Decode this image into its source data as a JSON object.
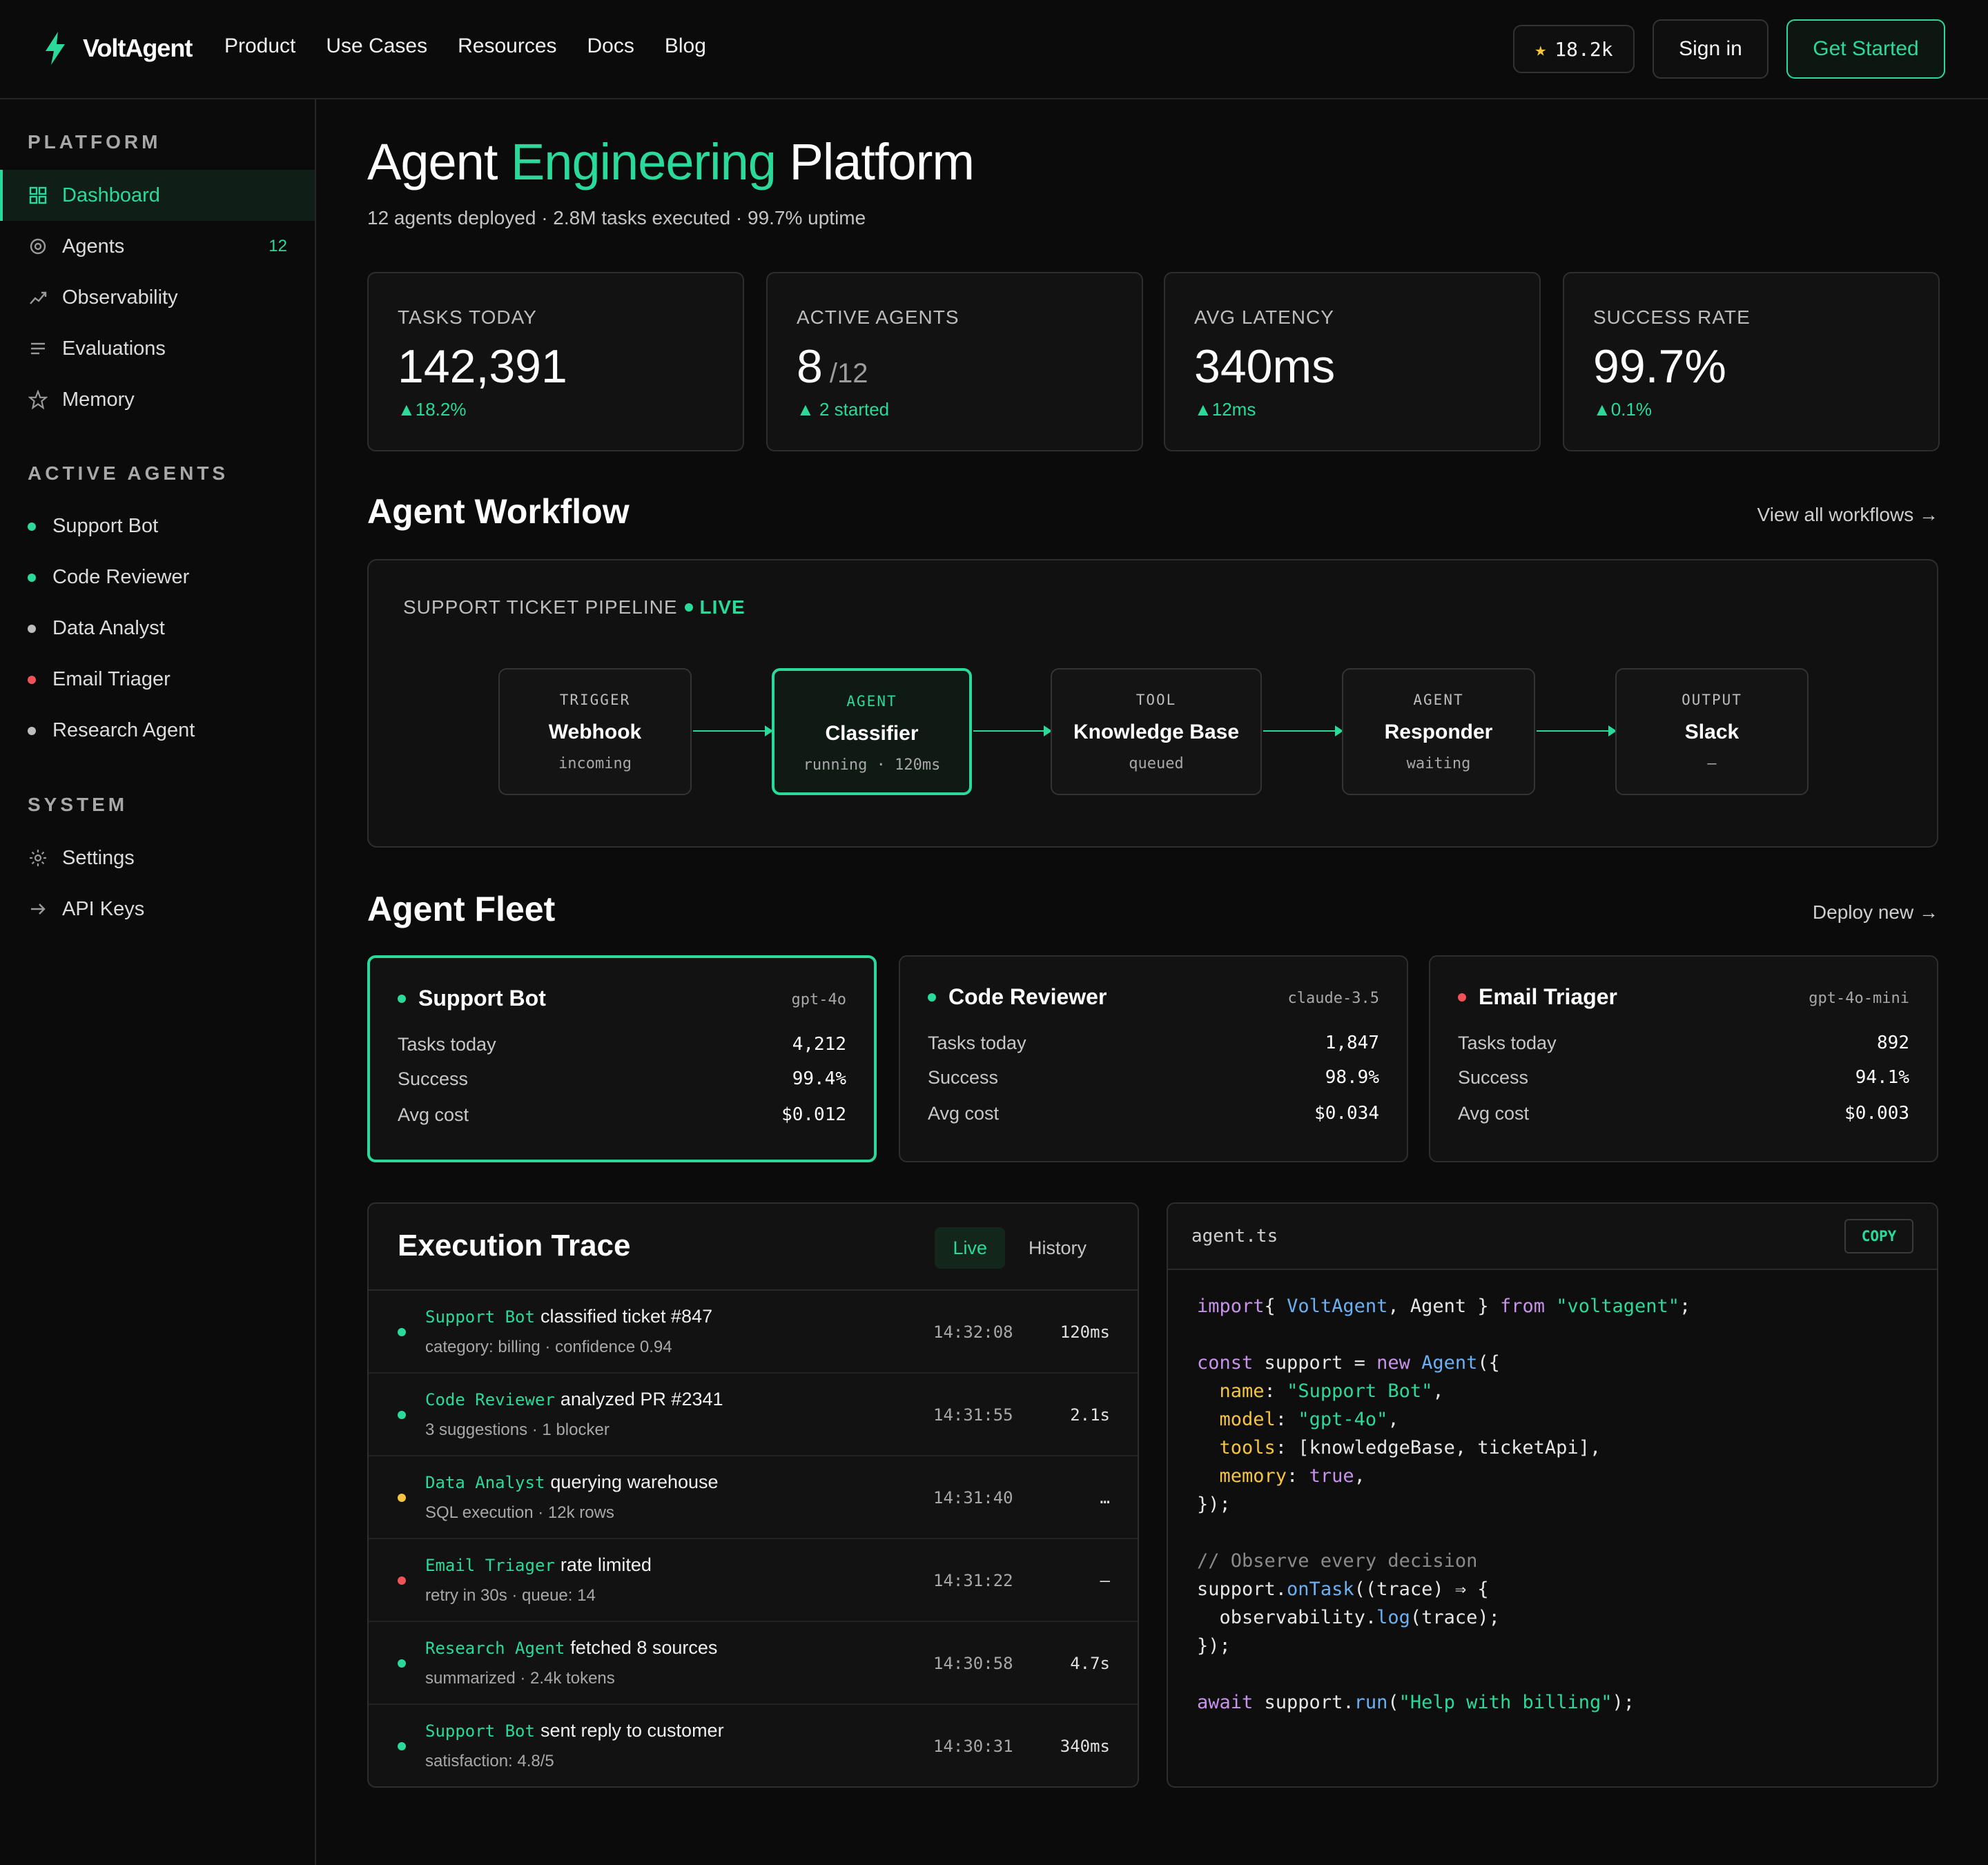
{
  "brand": {
    "name": "VoltAgent",
    "accent": "#2bd99a"
  },
  "nav": {
    "items": [
      "Product",
      "Use Cases",
      "Resources",
      "Docs",
      "Blog"
    ]
  },
  "actions": {
    "stars": "18.2k",
    "signin": "Sign in",
    "get_started": "Get Started"
  },
  "sidebar": {
    "platform_heading": "PLATFORM",
    "platform": [
      {
        "label": "Dashboard",
        "icon": "grid-icon"
      },
      {
        "label": "Agents",
        "icon": "target-icon",
        "badge": "12"
      },
      {
        "label": "Observability",
        "icon": "trend-icon"
      },
      {
        "label": "Evaluations",
        "icon": "list-icon"
      },
      {
        "label": "Memory",
        "icon": "star-icon"
      }
    ],
    "agents_heading": "ACTIVE AGENTS",
    "agents": [
      {
        "label": "Support Bot",
        "status": "green"
      },
      {
        "label": "Code Reviewer",
        "status": "green"
      },
      {
        "label": "Data Analyst",
        "status": "gray"
      },
      {
        "label": "Email Triager",
        "status": "red"
      },
      {
        "label": "Research Agent",
        "status": "gray"
      }
    ],
    "system_heading": "SYSTEM",
    "system": [
      {
        "label": "Settings",
        "icon": "gear-icon"
      },
      {
        "label": "API Keys",
        "icon": "arrow-right-icon"
      }
    ]
  },
  "header": {
    "title_pre": "Agent ",
    "title_hl": "Engineering",
    "title_post": " Platform",
    "subtitle": "12 agents deployed · 2.8M tasks executed · 99.7% uptime"
  },
  "stats": [
    {
      "label": "TASKS TODAY",
      "value": "142,391",
      "suffix": "",
      "delta": "18.2%"
    },
    {
      "label": "ACTIVE AGENTS",
      "value": "8",
      "suffix": "/12",
      "delta": "2 started"
    },
    {
      "label": "AVG LATENCY",
      "value": "340ms",
      "suffix": "",
      "delta": "12ms"
    },
    {
      "label": "SUCCESS RATE",
      "value": "99.7%",
      "suffix": "",
      "delta": "0.1%"
    }
  ],
  "workflow": {
    "title": "Agent Workflow",
    "link": "View all workflows →",
    "pipeline": "SUPPORT TICKET PIPELINE",
    "live": "LIVE",
    "nodes": [
      {
        "kind": "TRIGGER",
        "name": "Webhook",
        "status": "incoming"
      },
      {
        "kind": "AGENT",
        "name": "Classifier",
        "status": "running · 120ms"
      },
      {
        "kind": "TOOL",
        "name": "Knowledge Base",
        "status": "queued"
      },
      {
        "kind": "AGENT",
        "name": "Responder",
        "status": "waiting"
      },
      {
        "kind": "OUTPUT",
        "name": "Slack",
        "status": "—"
      }
    ]
  },
  "fleet": {
    "title": "Agent Fleet",
    "link": "Deploy new →",
    "labels": {
      "tasks": "Tasks today",
      "success": "Success",
      "cost": "Avg cost"
    },
    "cards": [
      {
        "name": "Support Bot",
        "model": "gpt-4o",
        "tasks": "4,212",
        "success": "99.4%",
        "cost": "$0.012"
      },
      {
        "name": "Code Reviewer",
        "model": "claude-3.5",
        "tasks": "1,847",
        "success": "98.9%",
        "cost": "$0.034"
      },
      {
        "name": "Email Triager",
        "model": "gpt-4o-mini",
        "tasks": "892",
        "success": "94.1%",
        "cost": "$0.003"
      }
    ]
  },
  "trace": {
    "title": "Execution Trace",
    "tabs": [
      "Live",
      "History"
    ],
    "rows": [
      {
        "agent": "Support Bot",
        "action": "classified ticket #847",
        "detail": "category: billing · confidence 0.94",
        "time": "14:32:08",
        "dur": "120ms",
        "status": "green"
      },
      {
        "agent": "Code Reviewer",
        "action": "analyzed PR #2341",
        "detail": "3 suggestions · 1 blocker",
        "time": "14:31:55",
        "dur": "2.1s",
        "status": "green"
      },
      {
        "agent": "Data Analyst",
        "action": "querying warehouse",
        "detail": "SQL execution · 12k rows",
        "time": "14:31:40",
        "dur": "…",
        "status": "yellow"
      },
      {
        "agent": "Email Triager",
        "action": "rate limited",
        "detail": "retry in 30s · queue: 14",
        "time": "14:31:22",
        "dur": "—",
        "status": "red"
      },
      {
        "agent": "Research Agent",
        "action": "fetched 8 sources",
        "detail": "summarized · 2.4k tokens",
        "time": "14:30:58",
        "dur": "4.7s",
        "status": "green"
      },
      {
        "agent": "Support Bot",
        "action": "sent reply to customer",
        "detail": "satisfaction: 4.8/5",
        "time": "14:30:31",
        "dur": "340ms",
        "status": "green"
      }
    ]
  },
  "code": {
    "file": "agent.ts",
    "copy": "COPY",
    "lines": [
      [
        [
          "kw",
          "import"
        ],
        [
          "",
          "{ "
        ],
        [
          "fn",
          "VoltAgent"
        ],
        [
          "",
          ", Agent } "
        ],
        [
          "kw",
          "from"
        ],
        [
          "",
          ""
        ],
        [
          "str",
          " \"voltagent\""
        ],
        [
          "",
          ";"
        ]
      ],
      [],
      [
        [
          "kw",
          "const"
        ],
        [
          "",
          " support = "
        ],
        [
          "kw",
          "new"
        ],
        [
          "fn",
          " Agent"
        ],
        [
          "",
          "({"
        ]
      ],
      [
        [
          "",
          ""
        ],
        [
          "prop",
          "  name"
        ],
        [
          "",
          ": "
        ],
        [
          "str",
          "\"Support Bot\""
        ],
        [
          "",
          ","
        ]
      ],
      [
        [
          "prop",
          "  model"
        ],
        [
          "",
          ": "
        ],
        [
          "str",
          "\"gpt-4o\""
        ],
        [
          "",
          ","
        ]
      ],
      [
        [
          "prop",
          "  tools"
        ],
        [
          "",
          ": [knowledgeBase, ticketApi],"
        ]
      ],
      [
        [
          "prop",
          "  memory"
        ],
        [
          "",
          ": "
        ],
        [
          "kw",
          "true"
        ],
        [
          "",
          ","
        ]
      ],
      [
        [
          "",
          "});"
        ]
      ],
      [],
      [
        [
          "cm",
          "// Observe every decision"
        ]
      ],
      [
        [
          "",
          "support."
        ],
        [
          "fn",
          "onTask"
        ],
        [
          "",
          "((trace) ⇒ {"
        ]
      ],
      [
        [
          "",
          "  observability."
        ],
        [
          "fn",
          "log"
        ],
        [
          "",
          "(trace);"
        ]
      ],
      [
        [
          "",
          "});"
        ]
      ],
      [],
      [
        [
          "kw",
          "await"
        ],
        [
          "",
          " support."
        ],
        [
          "fn",
          "run"
        ],
        [
          "",
          "("
        ],
        [
          "str",
          "\"Help with billing\""
        ],
        [
          "",
          ");"
        ]
      ]
    ]
  }
}
